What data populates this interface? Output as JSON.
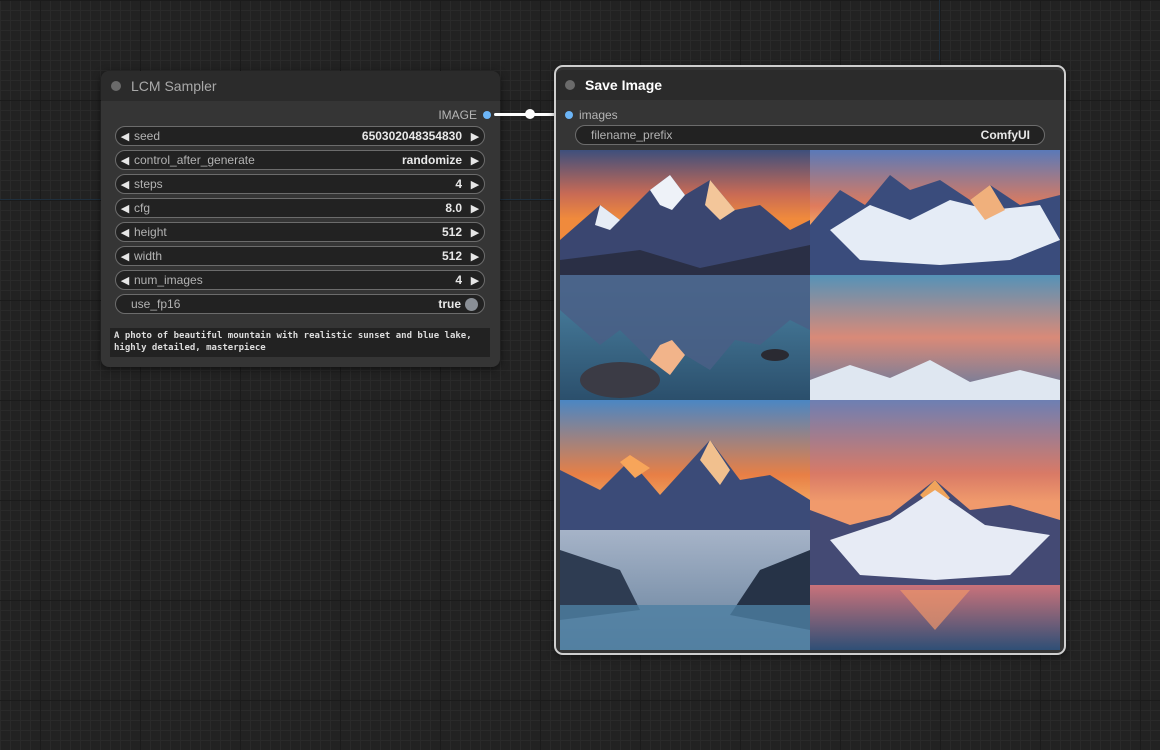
{
  "sampler": {
    "title": "LCM Sampler",
    "output_label": "IMAGE",
    "widgets": [
      {
        "label": "seed",
        "value": "650302048354830"
      },
      {
        "label": "control_after_generate",
        "value": "randomize"
      },
      {
        "label": "steps",
        "value": "4"
      },
      {
        "label": "cfg",
        "value": "8.0"
      },
      {
        "label": "height",
        "value": "512"
      },
      {
        "label": "width",
        "value": "512"
      },
      {
        "label": "num_images",
        "value": "4"
      }
    ],
    "toggle": {
      "label": "use_fp16",
      "value": "true"
    },
    "prompt": "A photo of beautiful mountain with realistic sunset and blue lake, highly detailed, masterpiece"
  },
  "save": {
    "title": "Save Image",
    "input_label": "images",
    "filename_prefix_label": "filename_prefix",
    "filename_prefix_value": "ComfyUI"
  },
  "colors": {
    "slot": "#6cb5f7",
    "canvas": "#222222",
    "node": "#353535"
  },
  "icons": {
    "decrement": "◀",
    "increment": "▶"
  }
}
